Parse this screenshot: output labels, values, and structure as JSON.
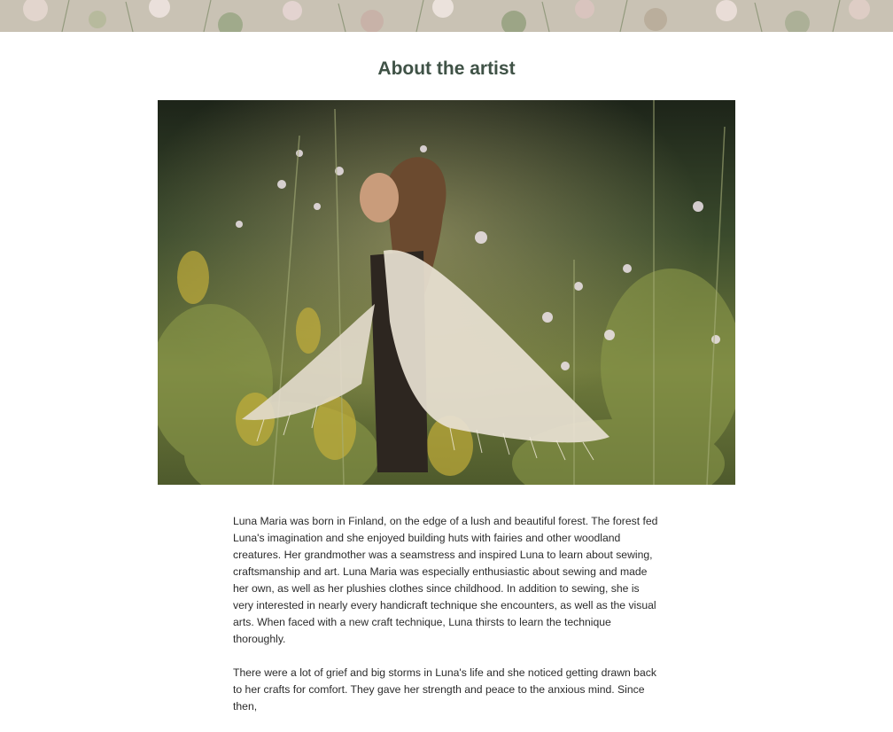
{
  "banner": {
    "image": "wildflower-meadow-banner"
  },
  "page": {
    "title": "About the artist"
  },
  "hero": {
    "image": "artist-in-meadow-photo"
  },
  "bio": {
    "paragraphs": [
      "Luna Maria was born in Finland, on the edge of a lush and beautiful forest. The forest fed Luna's imagination and she enjoyed building huts with fairies and other woodland creatures. Her grandmother was a seamstress and inspired Luna to learn about sewing, craftsmanship and art. Luna Maria was especially enthusiastic about sewing and made her own, as well as her plushies clothes since childhood. In addition to sewing, she is very interested in nearly every handicraft technique she encounters, as well as the visual arts. When faced with a new craft technique, Luna thirsts to learn the technique thoroughly.",
      "There were a lot of grief and big storms in Luna's life and she noticed getting drawn back to her crafts for comfort. They gave her strength and peace to the anxious mind. Since then,"
    ]
  }
}
